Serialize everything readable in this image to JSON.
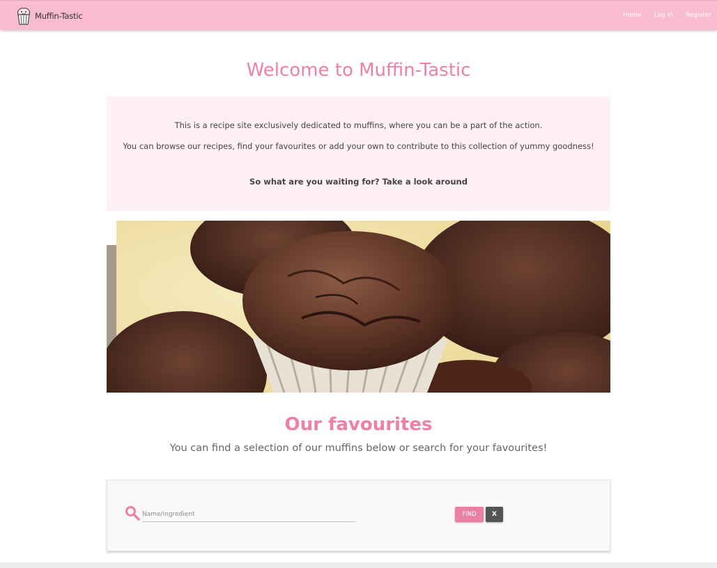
{
  "navbar": {
    "brand": "Muffin-Tastic",
    "links": [
      "Home",
      "Log In",
      "Register"
    ],
    "logo_icon": "muffin-logo-icon",
    "background": "#f8bbd0"
  },
  "welcome": {
    "title": "Welcome to Muffin-Tastic",
    "p1": "This is a recipe site exclusively dedicated to muffins, where you can be a part of the action.",
    "p2": "You can browse our recipes, find your favourites or add your own to contribute to this collection of yummy goodness!",
    "p3": "So what are you waiting for? Take a look around"
  },
  "carousel": {
    "image": "chocolate-muffins-photo"
  },
  "favourites": {
    "title": "Our favourites",
    "subtitle": "You can find a selection of our muffins below or search for your favourites!"
  },
  "search": {
    "placeholder": "Name/ingredient",
    "value": "",
    "find_label": "FIND",
    "clear_label": "X",
    "icon": "search-icon"
  },
  "colors": {
    "accent": "#f07fa6",
    "intro_bg": "#fff0f4",
    "button_find": "#ec7fa4",
    "button_clear": "#555555"
  }
}
